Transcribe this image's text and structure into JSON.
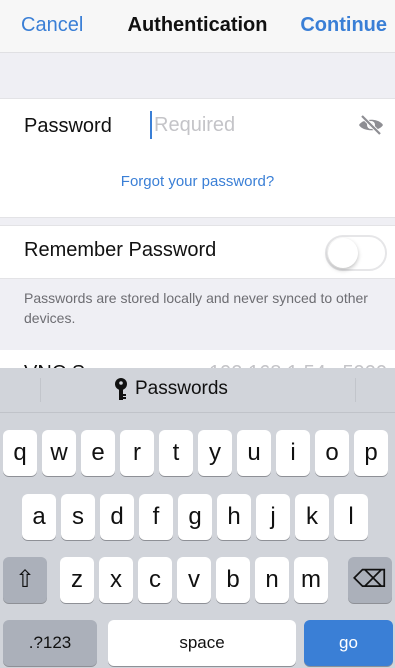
{
  "nav": {
    "cancel": "Cancel",
    "title": "Authentication",
    "continue": "Continue"
  },
  "password": {
    "label": "Password",
    "placeholder": "Required"
  },
  "forgot_link": "Forgot your password?",
  "remember": {
    "label": "Remember Password",
    "toggle_on": false
  },
  "footnote": "Passwords are stored locally and never synced to other devices.",
  "peek_row": {
    "left": "VNC S",
    "right": "192.168.1.54 : 5900"
  },
  "keyboard": {
    "bar_label": "Passwords",
    "row1": [
      "q",
      "w",
      "e",
      "r",
      "t",
      "y",
      "u",
      "i",
      "o",
      "p"
    ],
    "row2": [
      "a",
      "s",
      "d",
      "f",
      "g",
      "h",
      "j",
      "k",
      "l"
    ],
    "row3": [
      "z",
      "x",
      "c",
      "v",
      "b",
      "n",
      "m"
    ],
    "shift": "⇧",
    "backspace": "⌫",
    "numbers": ".?123",
    "space": "space",
    "go": "go"
  },
  "colors": {
    "accent": "#3a7fd6",
    "background": "#efeff4",
    "keyboard": "#d1d4da"
  }
}
